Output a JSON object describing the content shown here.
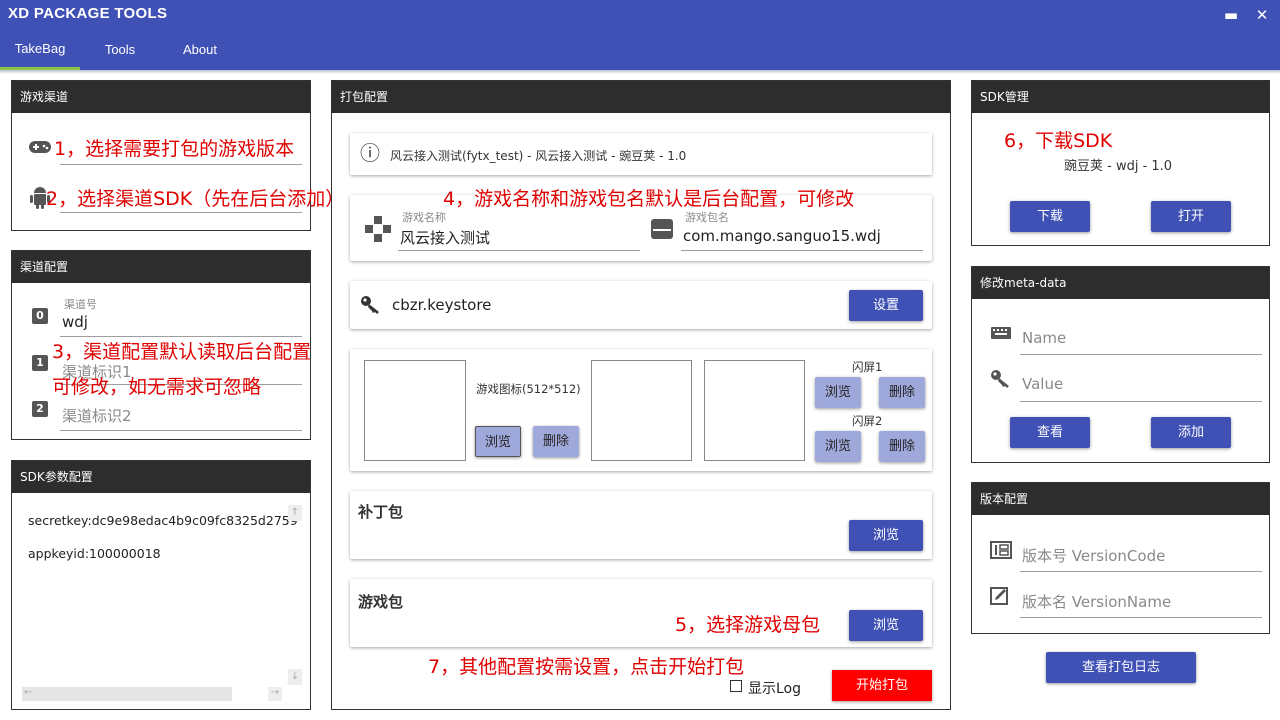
{
  "app": {
    "title": "XD PACKAGE TOOLS",
    "minimize": "▬",
    "close": "✕"
  },
  "nav": {
    "tabs": [
      "TakeBag",
      "Tools",
      "About"
    ]
  },
  "channel_panel": {
    "title": "游戏渠道",
    "annot1": "1，选择需要打包的游戏版本",
    "annot2": "2，选择渠道SDK（先在后台添加）"
  },
  "channel_config": {
    "title": "渠道配置",
    "channel_no_label": "渠道号",
    "channel_no_value": "wdj",
    "tag1_placeholder": "渠道标识1",
    "tag2_placeholder": "渠道标识2",
    "badges": [
      "0",
      "1",
      "2"
    ],
    "annot3a": "3，渠道配置默认读取后台配置",
    "annot3b": "可修改，如无需求可忽略"
  },
  "sdk_params": {
    "title": "SDK参数配置",
    "lines": [
      "secretkey:dc9e98edac4b9c09fc8325d2759",
      "appkeyid:100000018"
    ],
    "scroll_up": "↑",
    "scroll_down": "↓",
    "scroll_left": "←",
    "scroll_right": "→"
  },
  "pack_config": {
    "title": "打包配置",
    "info_text": "风云接入测试(fytx_test) - 风云接入测试 - 豌豆荚 - 1.0",
    "info_icon": "ⓘ",
    "game_name_label": "游戏名称",
    "game_name_value": "风云接入测试",
    "package_name_label": "游戏包名",
    "package_name_value": "com.mango.sanguo15.wdj",
    "annot4": "4，游戏名称和游戏包名默认是后台配置，可修改",
    "keystore_value": "cbzr.keystore",
    "keystore_button": "设置",
    "icon_label": "游戏图标(512*512)",
    "browse": "浏览",
    "delete": "删除",
    "splash1_label": "闪屏1",
    "splash2_label": "闪屏2",
    "patch_title": "补丁包",
    "game_pack_title": "游戏包",
    "annot5": "5，选择游戏母包",
    "annot7": "7，其他配置按需设置，点击开始打包",
    "show_log_label": "显示Log",
    "start_button": "开始打包"
  },
  "sdk_manage": {
    "title": "SDK管理",
    "annot6": "6，下载SDK",
    "sdk_info": "豌豆荚 - wdj - 1.0",
    "download_button": "下载",
    "open_button": "打开"
  },
  "meta_data": {
    "title": "修改meta-data",
    "name_placeholder": "Name",
    "value_placeholder": "Value",
    "view_button": "查看",
    "add_button": "添加"
  },
  "version_config": {
    "title": "版本配置",
    "code_placeholder": "版本号 VersionCode",
    "name_placeholder": "版本名 VersionName"
  },
  "log_button": "查看打包日志",
  "colors": {
    "primary": "#3f51b5",
    "accent_bar": "#8bc34a",
    "start": "#ff0000",
    "annotation": "#e00000",
    "panel_header": "#2d2d2d"
  }
}
